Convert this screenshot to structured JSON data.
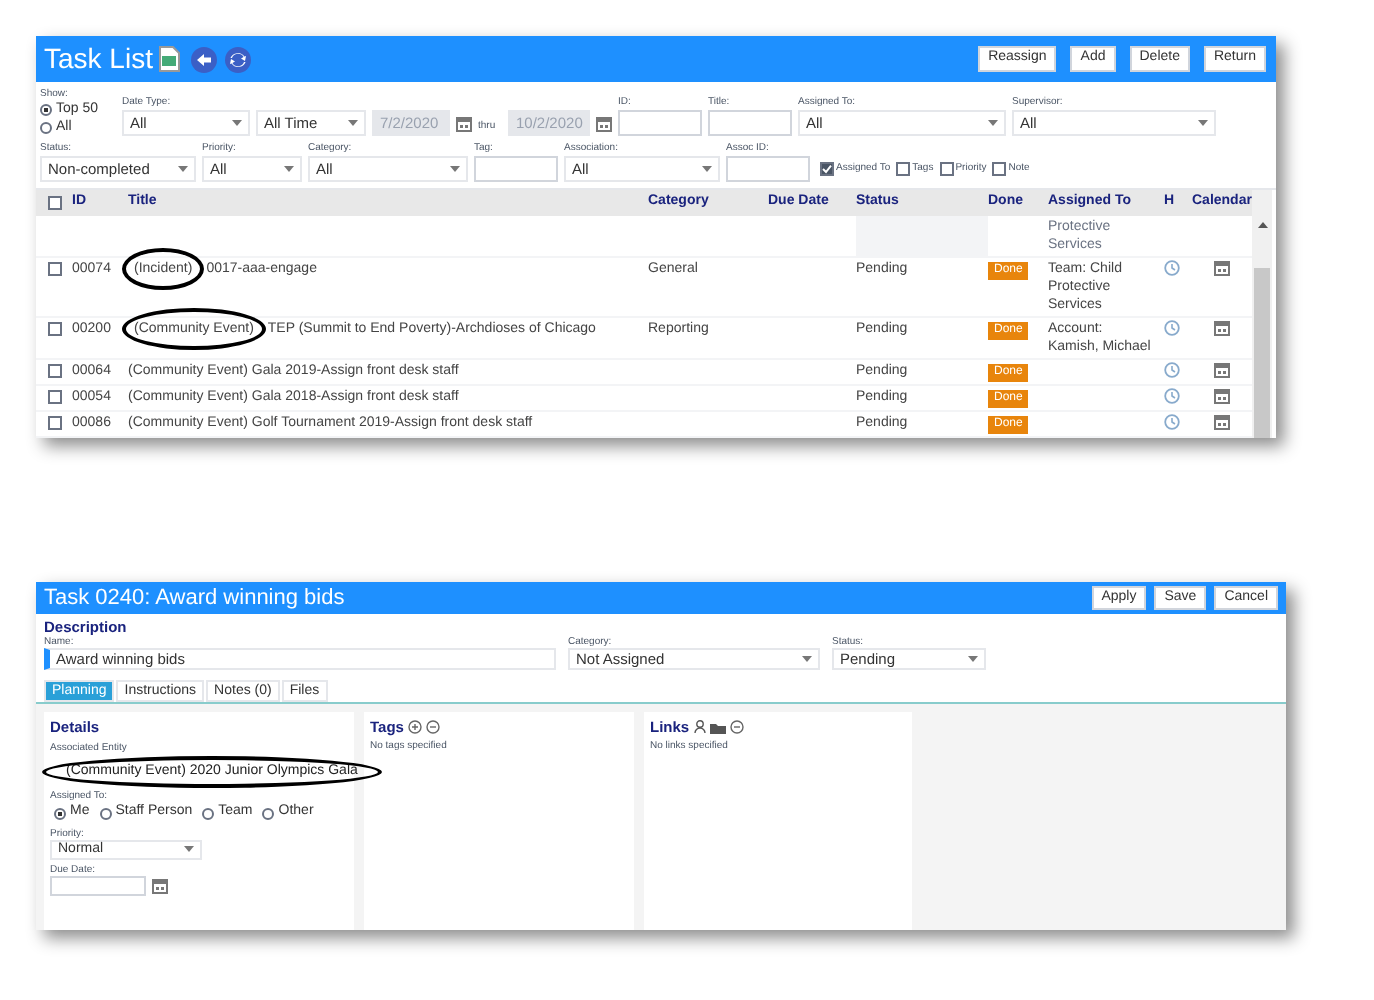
{
  "task_list": {
    "title": "Task List",
    "buttons": [
      "Reassign",
      "Add",
      "Delete",
      "Return"
    ],
    "filter_rows": [
      [
        {
          "kind": "radios",
          "label": "Show:",
          "options": [
            {
              "label": "Top 50",
              "selected": true
            },
            {
              "label": "All",
              "selected": false
            }
          ]
        },
        {
          "kind": "select",
          "label": "Date Type:",
          "value": "All"
        },
        {
          "kind": "select",
          "value": "All Time"
        },
        {
          "kind": "date",
          "value": "7/2/2020",
          "disabled": true
        },
        {
          "kind": "word",
          "text": "thru"
        },
        {
          "kind": "date",
          "value": "10/2/2020",
          "disabled": true
        },
        {
          "kind": "text",
          "label": "ID:"
        },
        {
          "kind": "text",
          "label": "Title:"
        },
        {
          "kind": "select",
          "label": "Assigned To:",
          "value": "All"
        },
        {
          "kind": "select",
          "label": "Supervisor:",
          "value": "All"
        }
      ],
      [
        {
          "kind": "select",
          "label": "Status:",
          "value": "Non-completed"
        },
        {
          "kind": "select",
          "label": "Priority:",
          "value": "All"
        },
        {
          "kind": "select",
          "label": "Category:",
          "value": "All"
        },
        {
          "kind": "text",
          "label": "Tag:"
        },
        {
          "kind": "select",
          "label": "Association:",
          "value": "All"
        },
        {
          "kind": "text",
          "label": "Assoc ID:"
        },
        {
          "kind": "checks",
          "options": [
            {
              "label": "Assigned To",
              "checked": true
            },
            {
              "label": "Tags",
              "checked": false
            },
            {
              "label": "Priority",
              "checked": false
            },
            {
              "label": "Note",
              "checked": false
            }
          ]
        }
      ]
    ],
    "table": {
      "select_all_checked": false,
      "columns": [
        "ID",
        "Title",
        "Category",
        "Due Date",
        "Status",
        "Done",
        "Assigned To",
        "H",
        "Calendar"
      ],
      "rows": [
        {
          "kind": "partial",
          "assigned_to": "Protective Services"
        },
        {
          "kind": "task",
          "checked": false,
          "id": "00074",
          "tag": "(Incident)",
          "circled": true,
          "text": "0017-aaa-engage",
          "category": "General",
          "status": "Pending",
          "done": "Done",
          "assigned_to": "Team: Child Protective Services"
        },
        {
          "kind": "task",
          "checked": false,
          "id": "00200",
          "tag": "(Community Event)",
          "circled": true,
          "text": "TEP (Summit to End Poverty)-Archdioses of Chicago",
          "category": "Reporting",
          "status": "Pending",
          "done": "Done",
          "assigned_to": "Account: Kamish, Michael"
        },
        {
          "kind": "task",
          "checked": false,
          "id": "00064",
          "tag": "(Community Event)",
          "circled": false,
          "text": "Gala 2019-Assign front desk staff",
          "status": "Pending",
          "done": "Done"
        },
        {
          "kind": "task",
          "checked": false,
          "id": "00054",
          "tag": "(Community Event)",
          "circled": false,
          "text": "Gala 2018-Assign front desk staff",
          "status": "Pending",
          "done": "Done"
        },
        {
          "kind": "task",
          "checked": false,
          "id": "00086",
          "tag": "(Community Event)",
          "circled": false,
          "text": "Golf Tournament 2019-Assign front desk staff",
          "status": "Pending",
          "done": "Done"
        }
      ]
    }
  },
  "task_detail": {
    "title": "Task 0240: Award winning bids",
    "buttons": [
      "Apply",
      "Save",
      "Cancel"
    ],
    "section": "Description",
    "name": {
      "label": "Name:",
      "value": "Award winning bids"
    },
    "category": {
      "label": "Category:",
      "value": "Not Assigned"
    },
    "status": {
      "label": "Status:",
      "value": "Pending"
    },
    "tabs": [
      {
        "label": "Planning",
        "selected": true
      },
      {
        "label": "Instructions",
        "selected": false
      },
      {
        "label": "Notes (0)",
        "selected": false
      },
      {
        "label": "Files",
        "selected": false
      }
    ],
    "details": {
      "heading": "Details",
      "entity_label": "Associated Entity",
      "entity": "(Community Event) 2020 Junior Olympics Gala",
      "circled": true,
      "assigned_label": "Assigned To:",
      "assigned_options": [
        {
          "label": "Me",
          "selected": true
        },
        {
          "label": "Staff Person",
          "selected": false
        },
        {
          "label": "Team",
          "selected": false
        },
        {
          "label": "Other",
          "selected": false
        }
      ],
      "priority_label": "Priority:",
      "priority": "Normal",
      "due_label": "Due Date:"
    },
    "tags": {
      "heading": "Tags",
      "empty": "No tags specified"
    },
    "links": {
      "heading": "Links",
      "empty": "No links specified"
    }
  }
}
